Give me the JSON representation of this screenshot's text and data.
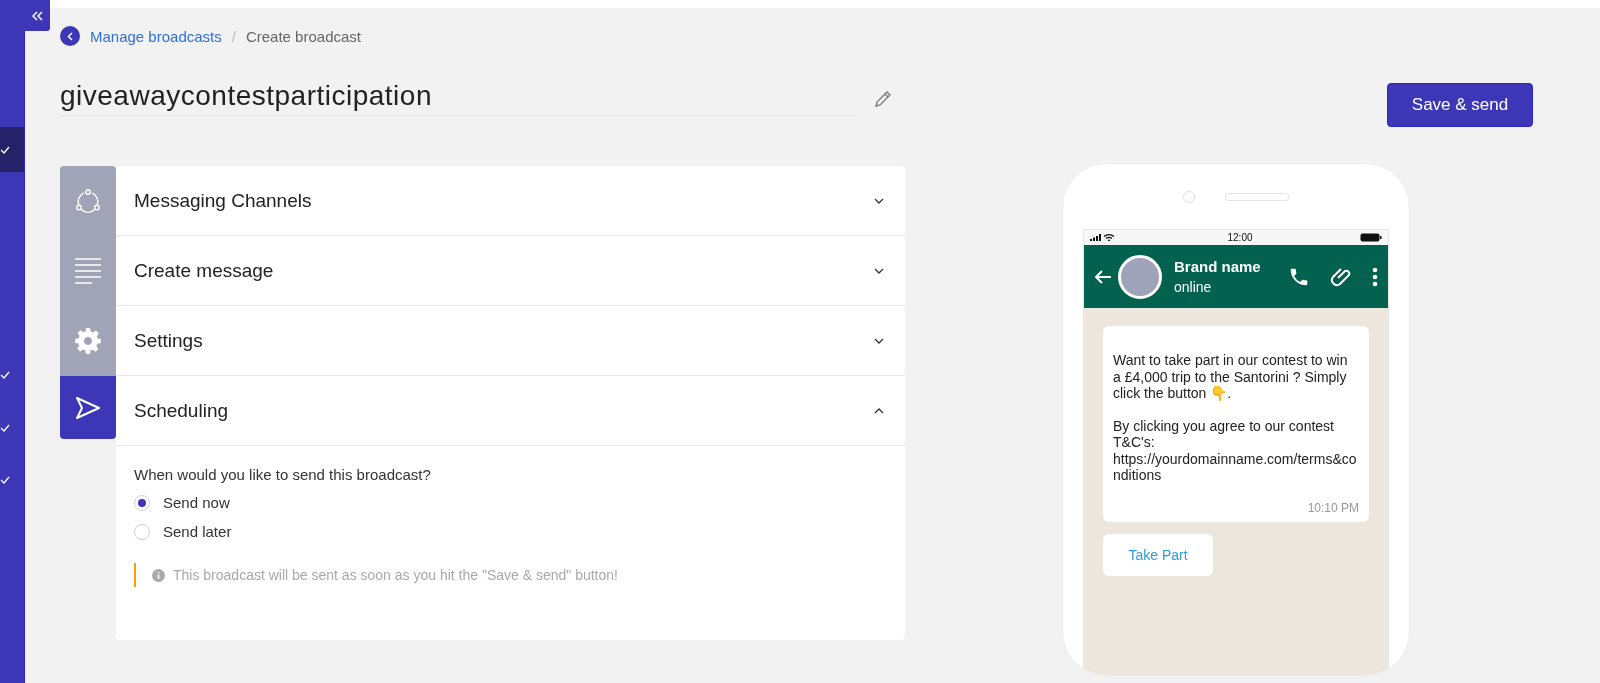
{
  "sidebar": {
    "items": [
      {
        "selected": true
      },
      {
        "selected": false
      },
      {
        "selected": false
      },
      {
        "selected": false
      }
    ]
  },
  "breadcrumb": {
    "link": "Manage broadcasts",
    "separator": "/",
    "current": "Create broadcast"
  },
  "broadcast_name": "giveawaycontestparticipation",
  "save_button": "Save & send",
  "sections": [
    {
      "kind": "channels",
      "title": "Messaging Channels",
      "expanded": false,
      "selected": false
    },
    {
      "kind": "message",
      "title": "Create message",
      "expanded": false,
      "selected": false
    },
    {
      "kind": "settings",
      "title": "Settings",
      "expanded": false,
      "selected": false
    },
    {
      "kind": "send",
      "title": "Scheduling",
      "expanded": true,
      "selected": true
    }
  ],
  "scheduling": {
    "question": "When would you like to send this broadcast?",
    "options": [
      {
        "label": "Send now",
        "selected": true
      },
      {
        "label": "Send later",
        "selected": false
      }
    ],
    "note": "This broadcast will be sent as soon as you hit the \"Save & send\" button!"
  },
  "preview": {
    "clock": "12:00",
    "contact_name": "Brand name",
    "contact_status": "online",
    "message": [
      "Want to take part in our contest to win a £4,000 trip to the Santorini ? Simply click the button 👇.",
      "By clicking you agree to our contest T&C's: https://yourdomainname.com/terms&conditions"
    ],
    "time": "10:10 PM",
    "action_button": "Take Part"
  }
}
